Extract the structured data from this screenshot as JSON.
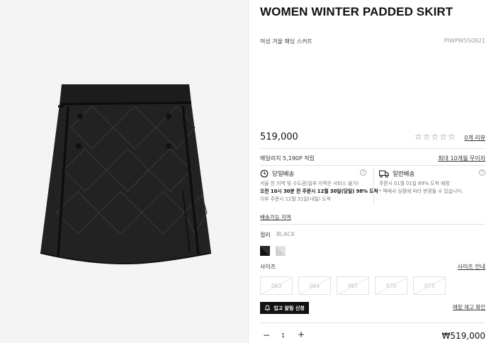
{
  "product": {
    "title": "WOMEN WINTER PADDED SKIRT",
    "korean_name": "여성 겨울 패딩 스커트",
    "code": "PIWPW550821",
    "image_icon": "skirt-photo",
    "price": "519,000",
    "rating_stars": "☆☆☆☆☆",
    "rating_value": 0,
    "review_link": "0개 리뷰"
  },
  "benefits": {
    "mileage": "메일리지 5,190P 적립",
    "installment": "최대 10개월 무이자"
  },
  "shipping": {
    "same_day": {
      "icon": "clock-icon",
      "title": "당일배송",
      "lines": [
        "서울 전 지역 및 수도권(일부 지역은 서비스 불가)",
        "오전 10시 30분 전 주문시 12월 30일(당일) 98% 도착",
        "이후 주문시 12월 31일(내일) 도착"
      ]
    },
    "standard": {
      "icon": "truck-icon",
      "title": "일반배송",
      "lines": [
        "주문시 01월 01일 89% 도착 예정",
        "* 택배사 상황에 따라 변경될 수 있습니다."
      ]
    },
    "area_link": "배송가능 지역"
  },
  "options": {
    "color_label": "컬러",
    "color_value": "BLACK",
    "swatches": [
      {
        "name": "black",
        "color": "#1a1a1a"
      },
      {
        "name": "gray",
        "color": "#cfcfcf"
      }
    ],
    "size_label": "사이즈",
    "size_guide": "사이즈 안내",
    "sizes": [
      "063",
      "064",
      "067",
      "070",
      "073"
    ]
  },
  "actions": {
    "restock_button": "입고 알림 신청",
    "stock_check": "매장 재고 확인"
  },
  "quantity": {
    "minus": "−",
    "value": "1",
    "plus": "+"
  },
  "total_price": "₩519,000",
  "colors": {
    "accent": "#111111",
    "muted": "#999999",
    "border": "#e2e2e2"
  }
}
